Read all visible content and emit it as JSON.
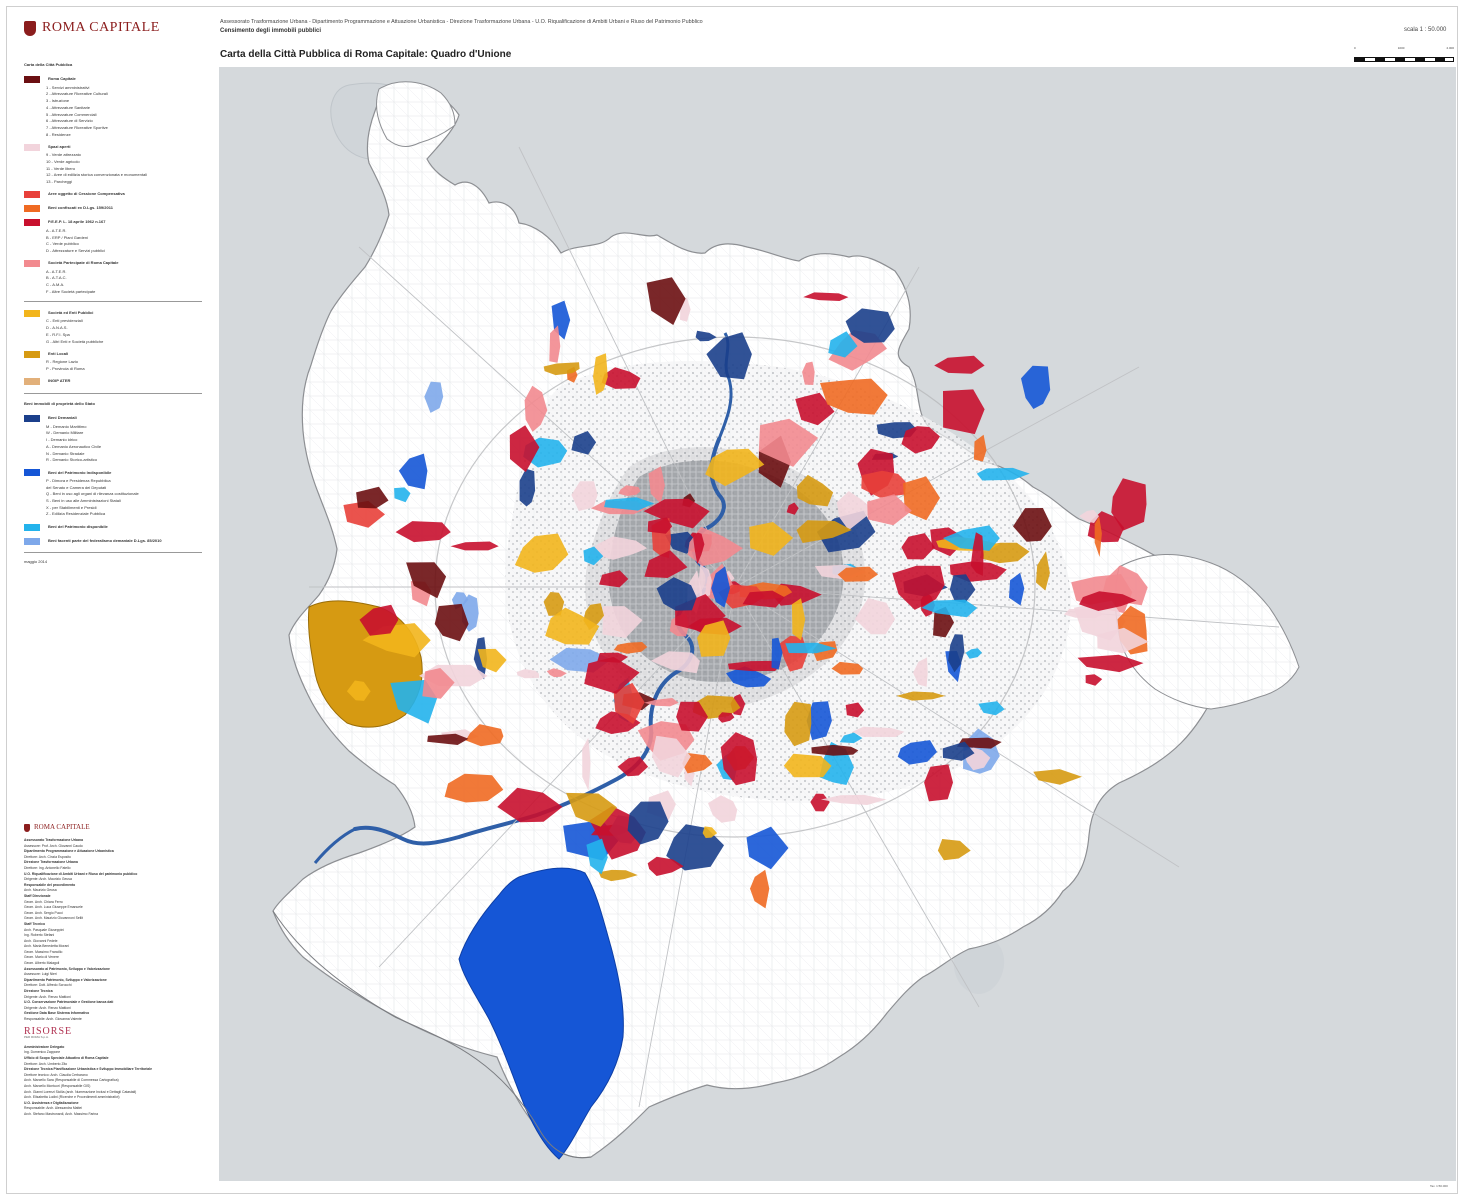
{
  "brand": {
    "logo_text": "ROMA CAPITALE"
  },
  "header": {
    "department": "Assessorato Trasformazione Urbana - Dipartimento Programmazione e Attuazione Urbanistica - Direzione Trasformazione Urbana - U.O. Riqualificazione di Ambiti Urbani e Riuso del Patrimonio Pubblico",
    "subtitle": "Censimento degli immobili pubblici",
    "title": "Carta della Città Pubblica di Roma Capitale: Quadro d'Unione",
    "scale": "scala  1 : 50.000",
    "scalebar_labels": [
      "0",
      "1000",
      "2.000"
    ]
  },
  "legend": {
    "title": "Carta della Città Pubblica",
    "groups": [
      {
        "label": "Roma Capitale",
        "color": "#6b0f12",
        "sub": [
          "1 - Servizi amministrativi",
          "2 - Attrezzature Ricreative Culturali",
          "3 - Istruzione",
          "4 - Attrezzature Sanitarie",
          "5 - Attrezzature Commerciali",
          "6 - Attrezzature di Servizio",
          "7 - Attrezzature Ricreative Sportive",
          "8 - Residenze"
        ]
      },
      {
        "label": "Spazi aperti",
        "color": "#f2d4dc",
        "sub": [
          "9 - Verde attrezzato",
          "10 - Verde agricolo",
          "11 - Verde libero",
          "12 - Aree di edilizia storica convenzionata e monumentali",
          "13 - Parcheggi"
        ]
      },
      {
        "label": "Aree oggetto di Cessione Compensativa",
        "color": "#e8403a",
        "sub": []
      },
      {
        "label": "Beni confiscati ex D.Lgs. 159/2011",
        "color": "#ef6a22",
        "sub": []
      },
      {
        "label": "P.E.E.P. L. 18 aprile 1962 n.167",
        "color": "#c8102e",
        "sub": [
          "A - A.T.E.R.",
          "B - ERP / Piani Gardeni",
          "C - Verde pubblico",
          "D - Attrezzature e Servizi pubblici"
        ]
      },
      {
        "label": "Società Partecipate di Roma Capitale",
        "color": "#f28a8f",
        "sub": [
          "A - A.T.E.R.",
          "B - A.T.A.C.",
          "C - A.M.A.",
          "F - Altre Società partecipate"
        ]
      },
      {
        "label": "Società ed Enti Pubblici",
        "color": "#f2b51c",
        "sep_before": true,
        "sub": [
          "C - Enti previdenziali",
          "D - A.N.A.S.",
          "E - R.F.I. Spa",
          "G - Altri Enti e Società pubbliche"
        ]
      },
      {
        "label": "Enti Locali",
        "color": "#d69a12",
        "sub": [
          "R - Regione Lazio",
          "P - Provincia di Roma"
        ]
      },
      {
        "label": "INGIP ATER",
        "color": "#e2b07a",
        "sub": []
      },
      {
        "label": "Beni immobili di proprietà dello Stato",
        "color": "",
        "sep_before": true,
        "heading": true,
        "sub": []
      },
      {
        "label": "Beni Demaniali",
        "color": "#1b3f8b",
        "sub": [
          "M - Demanio Marittimo",
          "W - Demanio Militare",
          "I - Demanio idrico",
          "A - Demanio Aeronautico Civile",
          "N - Demanio Stradale",
          "R - Demanio Storico-artistico"
        ]
      },
      {
        "label": "Beni del Patrimonio Indisponibile",
        "color": "#1556d6",
        "sub": [
          "P - Dimora e Presidenza Repubblica",
          "del Senato e Camera dei Deputati",
          "Q - Beni in uso agli organi di rilevanza costituzionale",
          "S - Beni in uso alle Amministrazioni Statali",
          "X - per Stabilimenti e Presidi",
          "Z - Edilizia Residenziale Pubblica"
        ]
      },
      {
        "label": "Beni del Patrimonio disponibile",
        "color": "#23b3ec",
        "sub": []
      },
      {
        "label": "Beni facenti parte del federalismo demaniale D.Lgs. 85/2010",
        "color": "#7ea8ea",
        "sub": []
      }
    ],
    "date": "maggio 2014"
  },
  "credits": {
    "logo_text": "ROMA CAPITALE",
    "lines": [
      {
        "t": "Assessorato Trasformazione Urbana",
        "b": true
      },
      {
        "t": "Assessore: Prof. Arch. Giovanni Caudo",
        "b": false
      },
      {
        "t": "Dipartimento Programmazione e Attuazione Urbanistica",
        "b": true
      },
      {
        "t": "Direttore: Arch. Cinzia Esposito",
        "b": false
      },
      {
        "t": "Direzione Trasformazione Urbana",
        "b": true
      },
      {
        "t": "Direttore: Ing. Antonello Fatello",
        "b": false
      },
      {
        "t": "U.O. Riqualificazione di Ambiti Urbani e Riuso del patrimonio pubblico",
        "b": true
      },
      {
        "t": "Dirigente: Arch. Maurizio Geusa",
        "b": false
      },
      {
        "t": "Responsabile del procedimento",
        "b": true
      },
      {
        "t": "Arch. Maurizio Geusa",
        "b": false
      },
      {
        "t": "Staff Direzionale",
        "b": true
      },
      {
        "t": "Geom. Arch. Chiara Ferro",
        "b": false
      },
      {
        "t": "Geom. Arch. Luca Giuseppe Emanuele",
        "b": false
      },
      {
        "t": "Geom. Arch. Sergio Pucci",
        "b": false
      },
      {
        "t": "Geom. Arch. Maurizio Giovannoni Sellit",
        "b": false
      },
      {
        "t": "Staff Tecnico",
        "b": true
      },
      {
        "t": "Arch. Pasquale Giuseppini",
        "b": false
      },
      {
        "t": "Ing. Roberto Stefani",
        "b": false
      },
      {
        "t": "Arch. Giovanni Fedele",
        "b": false
      },
      {
        "t": "Arch. Maria Benedetta Morani",
        "b": false
      },
      {
        "t": "Geom. Massimo Francillo",
        "b": false
      },
      {
        "t": "Geom. Mario di Venere",
        "b": false
      },
      {
        "t": "Geom. Alberto Malagoli",
        "b": false
      },
      {
        "t": "Assessorato al Patrimonio, Sviluppo e Valorizzazione",
        "b": true
      },
      {
        "t": "Assessore: Luigi Nieri",
        "b": false
      },
      {
        "t": "Dipartimento Patrimonio, Sviluppo e Valorizzazione",
        "b": true
      },
      {
        "t": "Direttore: Dott. Alfredo Scrocchi",
        "b": false
      },
      {
        "t": "Direzione Tecnica",
        "b": true
      },
      {
        "t": "Dirigente: Arch. Renzo Mattioni",
        "b": false
      },
      {
        "t": "U.O. Conservazione Patrimoniale e Gestione banca dati",
        "b": true
      },
      {
        "t": "Dirigente: Arch. Renzo Mattioni",
        "b": false
      },
      {
        "t": "Gestione Data Base Sistema Informativo",
        "b": true
      },
      {
        "t": "Responsabile: Arch. Giovanna Valente",
        "b": false
      }
    ],
    "risorse": "RISORSE",
    "risorse_sub": "PER ROMA S.p.A.",
    "lines2": [
      {
        "t": "Amministratore Delegato",
        "b": true
      },
      {
        "t": "Ing. Domenico Zappone",
        "b": false
      },
      {
        "t": "Ufficio di Scopo Speciale Attuativo di Roma Capitale",
        "b": true
      },
      {
        "t": "Direttore: Arch. Umberto Zito",
        "b": false
      },
      {
        "t": "Direzione Tecnica Pianificazione Urbanistica e Sviluppo Immobiliare Territoriale",
        "b": true
      },
      {
        "t": "Direttore tecnico: Arch. Claudia Cerbarano",
        "b": false
      },
      {
        "t": "Arch. Marcello Sara (Responsabile di Commessa Cartografica)",
        "b": false
      },
      {
        "t": "Arch. Marcello Montuori (Responsabile GIS)",
        "b": false
      },
      {
        "t": "Arch. Gianni Lorenzi Sicilia (arch. Numerazione Inclusi e Dettagli Catastali)",
        "b": false
      },
      {
        "t": "Arch. Elisabetta Lodini (Ricerche e Procedimenti amministrativi)",
        "b": false
      },
      {
        "t": "U.O. Assistenza e Digitalizzazione",
        "b": true
      },
      {
        "t": "Responsabile: Arch. Alessandra Mattei",
        "b": false
      },
      {
        "t": "Arch. Stefano Mastronardi, Arch. Massimo Farina",
        "b": false
      }
    ]
  },
  "map": {
    "description_ocean_color": "#d5d9dc",
    "page_code": "Tav. 1:50.000"
  }
}
